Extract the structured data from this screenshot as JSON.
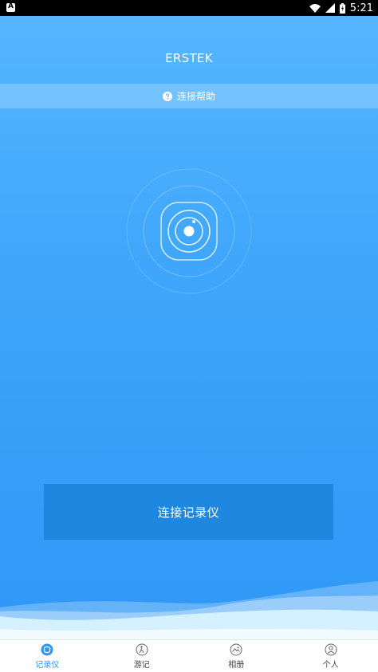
{
  "status_bar": {
    "time": "5:21"
  },
  "header": {
    "title": "ERSTEK"
  },
  "help": {
    "label": "连接帮助"
  },
  "main": {
    "connect_button_label": "连接记录仪"
  },
  "nav": {
    "items": [
      {
        "label": "记录仪",
        "icon": "recorder-icon",
        "active": true
      },
      {
        "label": "游记",
        "icon": "travel-notes-icon",
        "active": false
      },
      {
        "label": "相册",
        "icon": "album-icon",
        "active": false
      },
      {
        "label": "个人",
        "icon": "profile-icon",
        "active": false
      }
    ]
  },
  "colors": {
    "accent": "#2f97f6",
    "button": "#1e88e0",
    "header_bg": "#55b6ff"
  }
}
